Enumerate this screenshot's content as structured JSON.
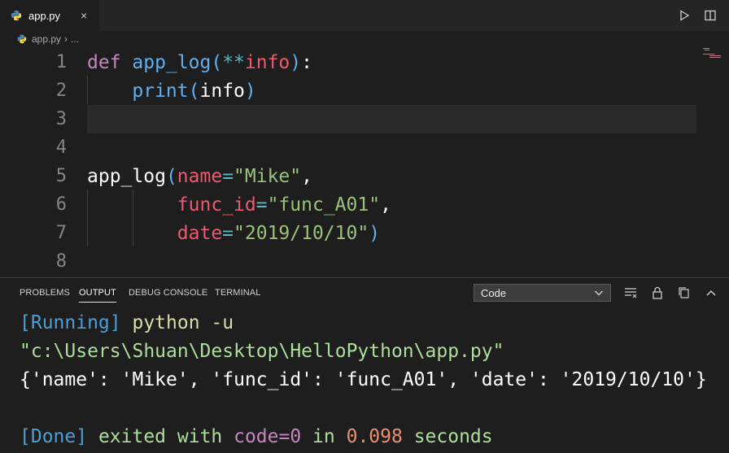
{
  "tab": {
    "label": "app.py",
    "close": "×"
  },
  "breadcrumb": {
    "file": "app.py",
    "sep": "›",
    "more": "..."
  },
  "editor": {
    "line_numbers": [
      "1",
      "2",
      "3",
      "4",
      "5",
      "6",
      "7",
      "8"
    ],
    "lines": [
      {
        "def": "def ",
        "fn": "app_log",
        "p1": "(",
        "op": "**",
        "param": "info",
        "p2": ")",
        "colon": ":"
      },
      {
        "indent": "    ",
        "fn": "print",
        "p1": "(",
        "arg": "info",
        "p2": ")"
      },
      {},
      {},
      {
        "fn": "app_log",
        "p1": "(",
        "k1": "name",
        "eq": "=",
        "v1": "\"Mike\"",
        "comma": ","
      },
      {
        "indent": "        ",
        "k": "func_id",
        "eq": "=",
        "v": "\"func_A01\"",
        "comma": ","
      },
      {
        "indent": "        ",
        "k": "date",
        "eq": "=",
        "v": "\"2019/10/10\"",
        "p2": ")"
      },
      {}
    ]
  },
  "panel": {
    "tabs": [
      "PROBLEMS",
      "OUTPUT",
      "DEBUG CONSOLE",
      "TERMINAL"
    ],
    "active_tab": "OUTPUT",
    "channel": "Code"
  },
  "output": {
    "running": "[Running]",
    "cmd": " python -u",
    "path": "\"c:\\Users\\Shuan\\Desktop\\HelloPython\\app.py\"",
    "result": "{'name': 'Mike', 'func_id': 'func_A01', 'date': '2019/10/10'}",
    "done": "[Done]",
    "exited": " exited with ",
    "code": "code=0",
    "in": " in ",
    "time": "0.098",
    "seconds": " seconds"
  }
}
